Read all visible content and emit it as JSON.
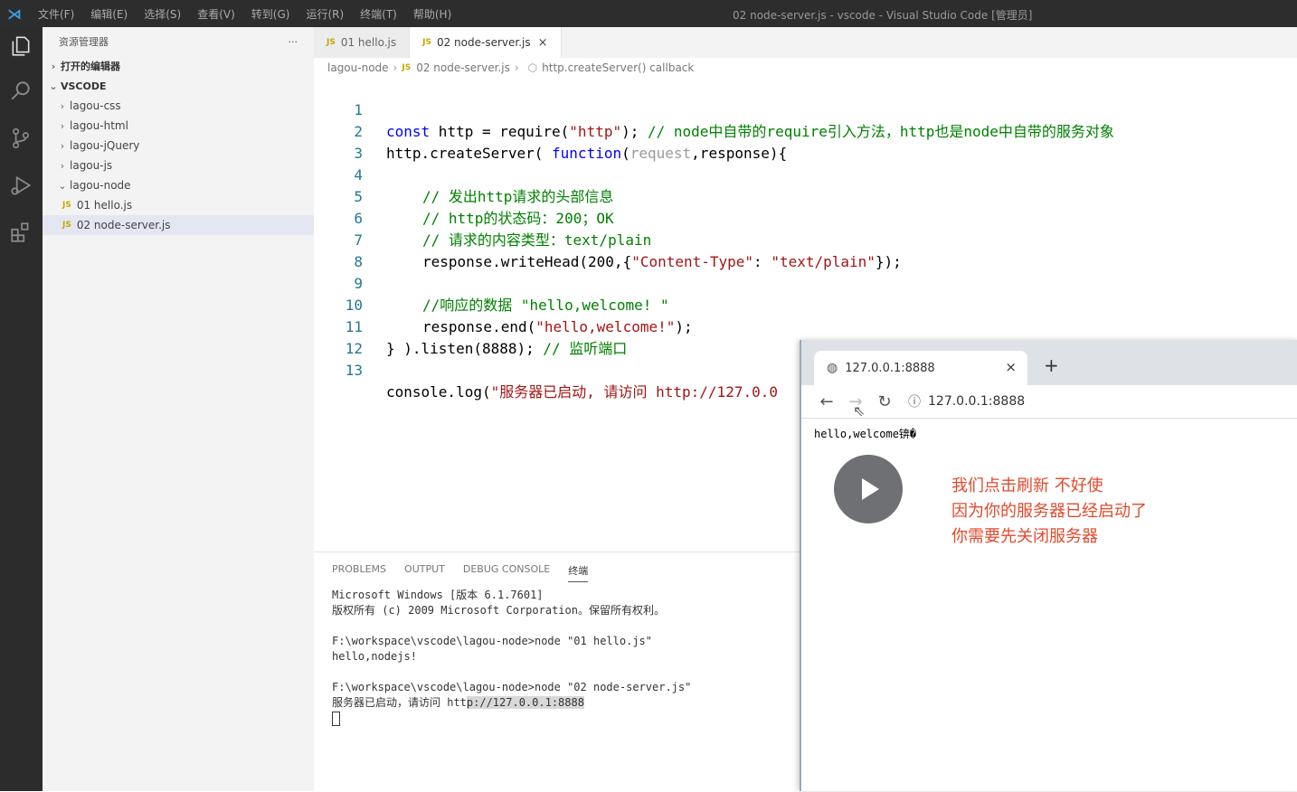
{
  "titlebar": {
    "menu": [
      "文件(F)",
      "编辑(E)",
      "选择(S)",
      "查看(V)",
      "转到(G)",
      "运行(R)",
      "终端(T)",
      "帮助(H)"
    ],
    "window_title": "02 node-server.js - vscode - Visual Studio Code [管理员]"
  },
  "activity": {
    "icons": [
      "explorer-icon",
      "search-icon",
      "source-control-icon",
      "run-debug-icon",
      "extensions-icon"
    ]
  },
  "sidebar": {
    "title": "资源管理器",
    "more": "···",
    "open_editors": "打开的编辑器",
    "workspace": "VSCODE",
    "folders": [
      "lagou-css",
      "lagou-html",
      "lagou-jQuery",
      "lagou-js",
      "lagou-node"
    ],
    "files": [
      "01 hello.js",
      "02 node-server.js"
    ],
    "js_badge": "JS"
  },
  "tabs": [
    {
      "label": "01 hello.js"
    },
    {
      "label": "02 node-server.js",
      "close": "×"
    }
  ],
  "breadcrumb": [
    "lagou-node",
    "02 node-server.js",
    "http.createServer() callback"
  ],
  "code": {
    "line_numbers": [
      "1",
      "2",
      "3",
      "4",
      "5",
      "6",
      "7",
      "8",
      "9",
      "10",
      "11",
      "12",
      "13"
    ],
    "l1": {
      "kw": "const",
      "a": " http = require(",
      "s": "\"http\"",
      "b": "); ",
      "c": "// node中自带的require引入方法，http也是node中自带的服务对象"
    },
    "l2": {
      "a": "http.createServer( ",
      "kw": "function",
      "b": "(",
      "p": "request",
      "c": ",response){"
    },
    "l4": "// 发出http请求的头部信息",
    "l5": "// http的状态码：200；OK",
    "l6": "// 请求的内容类型：text/plain",
    "l7": {
      "a": "response.writeHead(200,{",
      "s1": "\"Content-Type\"",
      "b": ": ",
      "s2": "\"text/plain\"",
      "c": "});"
    },
    "l9": "//响应的数据 \"hello,welcome! \"",
    "l10": {
      "a": "response.end(",
      "s": "\"hello,welcome!\"",
      "b": ");"
    },
    "l11": {
      "a": "} ).listen(8888); ",
      "c": "// 监听端口"
    },
    "l13": {
      "a": "console.log(",
      "s": "\"服务器已启动, 请访问 http://127.0.0"
    }
  },
  "panel": {
    "tabs": [
      "PROBLEMS",
      "OUTPUT",
      "DEBUG CONSOLE",
      "终端"
    ],
    "terminal": {
      "t1": "Microsoft Windows [版本 6.1.7601]",
      "t2": "版权所有 (c) 2009 Microsoft Corporation。保留所有权利。",
      "t3": "F:\\workspace\\vscode\\lagou-node>node \"01 hello.js\"",
      "t4": "hello,nodejs!",
      "t5": "F:\\workspace\\vscode\\lagou-node>node \"02 node-server.js\"",
      "t6a": "服务器已启动，请访问 htt",
      "t6b": "p://127.0.0.1:8888"
    }
  },
  "browser": {
    "tab_title": "127.0.0.1:8888",
    "tab_close": "×",
    "new_tab": "+",
    "address": "127.0.0.1:8888",
    "content": "hello,welcome锛�"
  },
  "overlay": {
    "caption": [
      "我们点击刷新 不好使",
      "因为你的服务器已经启动了",
      "你需要先关闭服务器"
    ]
  }
}
